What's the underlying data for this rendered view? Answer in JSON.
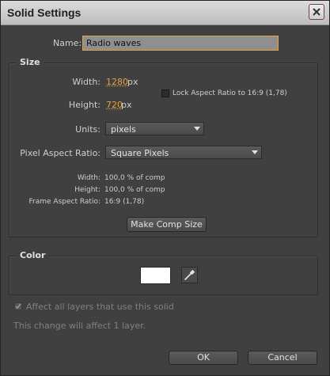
{
  "window": {
    "title": "Solid Settings"
  },
  "name": {
    "label": "Name:",
    "value": "Radio waves"
  },
  "size": {
    "heading": "Size",
    "width_label": "Width:",
    "width_value": "1280",
    "width_unit": "px",
    "height_label": "Height:",
    "height_value": "720",
    "height_unit": "px",
    "lock_label": "Lock Aspect Ratio to 16:9 (1,78)",
    "lock_checked": false,
    "units_label": "Units:",
    "units_value": "pixels",
    "par_label": "Pixel Aspect Ratio:",
    "par_value": "Square Pixels",
    "info": {
      "width_label": "Width:",
      "width_value": "100,0 % of comp",
      "height_label": "Height:",
      "height_value": "100,0 % of comp",
      "far_label": "Frame Aspect Ratio:",
      "far_value": "16:9 (1,78)"
    },
    "make_comp_size": "Make Comp Size"
  },
  "color": {
    "heading": "Color",
    "swatch_color": "#ffffff"
  },
  "affect_all": {
    "label": "Affect all layers that use this solid",
    "checked": true
  },
  "note": "This change will affect 1 layer.",
  "buttons": {
    "ok": "OK",
    "cancel": "Cancel"
  }
}
